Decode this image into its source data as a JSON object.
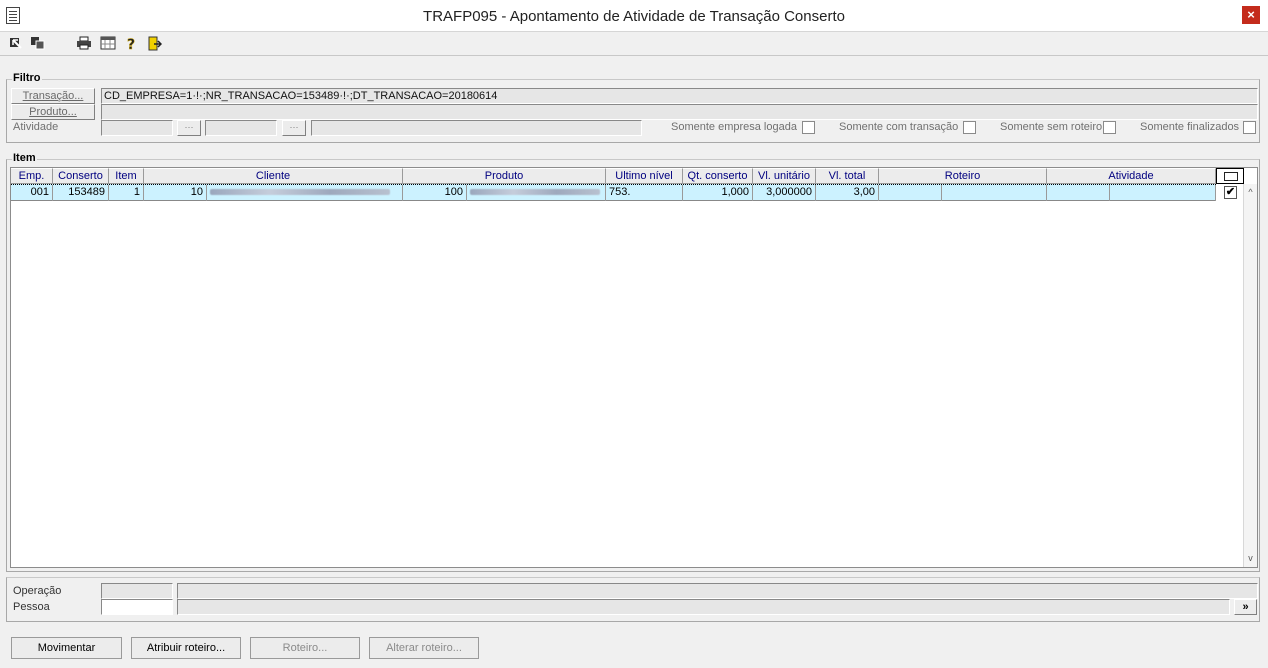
{
  "window": {
    "title": "TRAFP095 - Apontamento de Atividade de Transação Conserto",
    "close_label": "×"
  },
  "toolbar": {
    "icons": [
      "import-icon",
      "copy-icon",
      "print-icon",
      "calendar-icon",
      "help-icon",
      "exit-icon"
    ]
  },
  "filtro": {
    "title": "Filtro",
    "transacao_label": "Transação...",
    "transacao_value": "CD_EMPRESA=1·!·;NR_TRANSACAO=153489·!·;DT_TRANSACAO=20180614",
    "produto_label": "Produto...",
    "atividade_label": "Atividade",
    "lookup_label": "···",
    "options": [
      "Somente empresa logada",
      "Somente com transação",
      "Somente sem roteiro",
      "Somente finalizados"
    ]
  },
  "item": {
    "title": "Item",
    "columns": [
      "Emp.",
      "Conserto",
      "Item",
      "Cliente",
      "Produto",
      "Ultimo nível",
      "Qt. conserto",
      "Vl. unitário",
      "Vl. total",
      "Roteiro",
      "Atividade"
    ],
    "rows": [
      {
        "emp": "001",
        "conserto": "153489",
        "item": "1",
        "cliente_cod": "10",
        "produto_cod": "100",
        "ultimo_nivel": "753.",
        "qt_conserto": "1,000",
        "vl_unitario": "3,000000",
        "vl_total": "3,00",
        "checked": "✔"
      }
    ],
    "scroll_up": "^",
    "scroll_down": "v"
  },
  "footer": {
    "operacao_label": "Operação",
    "pessoa_label": "Pessoa",
    "expand_label": "»"
  },
  "buttons": {
    "movimentar": "Movimentar",
    "atribuir_roteiro": "Atribuir roteiro...",
    "roteiro": "Roteiro...",
    "alterar_roteiro": "Alterar roteiro..."
  }
}
